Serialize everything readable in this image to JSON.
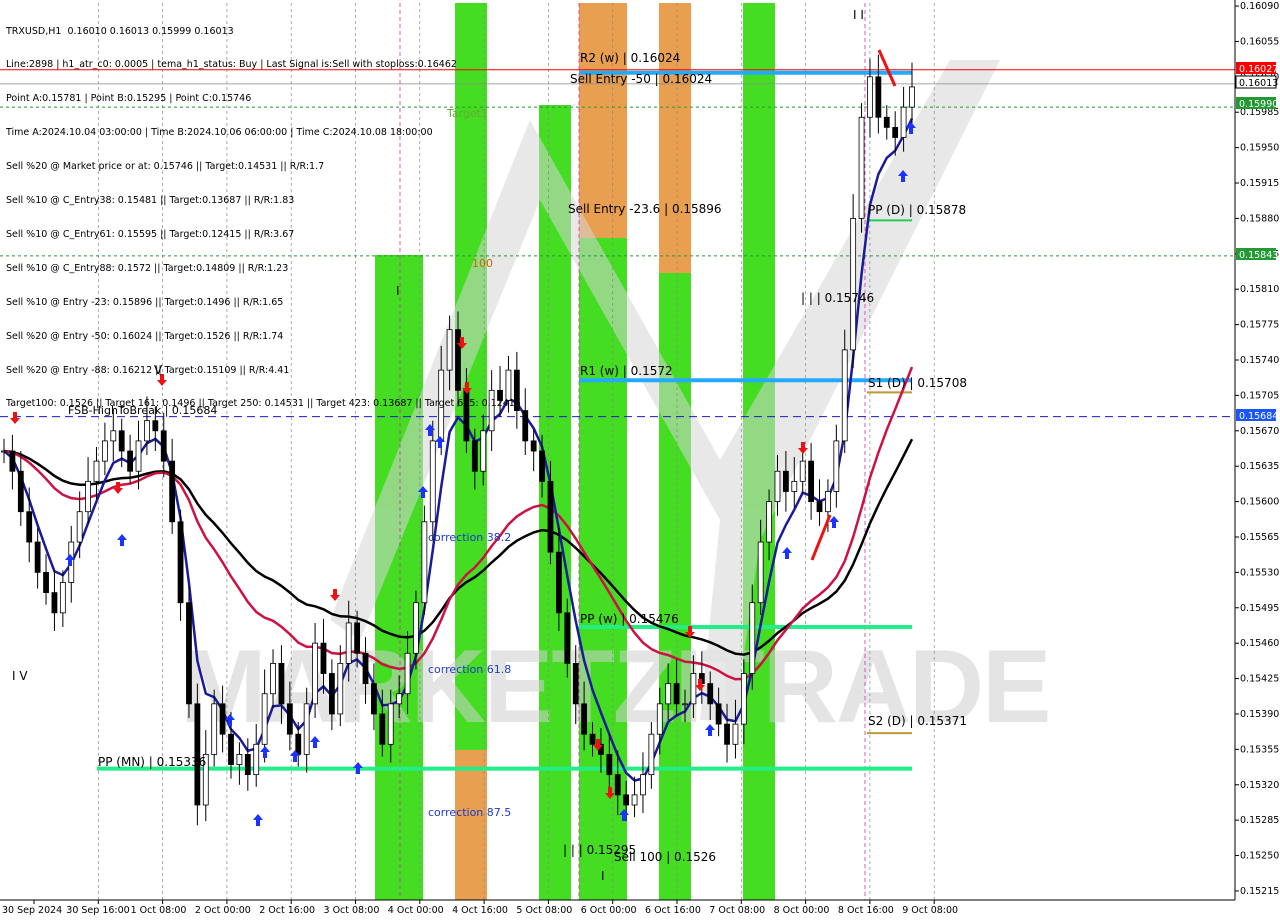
{
  "info": {
    "lines": [
      "TRXUSD,H1  0.16010 0.16013 0.15999 0.16013",
      "Line:2898 | h1_atr_c0: 0.0005 | tema_h1_status: Buy | Last Signal is:Sell with stoploss:0.16462",
      "Point A:0.15781 | Point B:0.15295 | Point C:0.15746",
      "Time A:2024.10.04 03:00:00 | Time B:2024.10.06 06:00:00 | Time C:2024.10.08 18:00:00",
      "Sell %20 @ Market price or at: 0.15746 || Target:0.14531 || R/R:1.7",
      "Sell %10 @ C_Entry38: 0.15481 || Target:0.13687 || R/R:1.83",
      "Sell %10 @ C_Entry61: 0.15595 || Target:0.12415 || R/R:3.67",
      "Sell %10 @ C_Entry88: 0.1572 || Target:0.14809 || R/R:1.23",
      "Sell %10 @ Entry -23: 0.15896 || Target:0.1496 || R/R:1.65",
      "Sell %20 @ Entry -50: 0.16024 || Target:0.1526 || R/R:1.74",
      "Sell %20 @ Entry -88: 0.16212 || Target:0.15109 || R/R:4.41",
      "Target100: 0.1526 || Target 161: 0.1496 || Target 250: 0.14531 || Target 423: 0.13687 || Target 685: 0.12415"
    ]
  },
  "colors": {
    "green": "#44dd22",
    "orange": "#e8a050",
    "blue_level": "#22aaff",
    "green_level": "#22ee88",
    "red_line": "#ff0000",
    "dark_blue": "#1a1a9a",
    "crimson": "#cc1144",
    "black": "#000000",
    "watermark": "#d8d8d8"
  },
  "price_tags": {
    "red": "0.16027",
    "black": "0.16013",
    "green1": "0.15990",
    "green2": "0.15843",
    "blue": "0.15684"
  },
  "levels": {
    "r2w": "R2 (w) | 0.16024",
    "sell_entry_50": "Sell Entry -50 | 0.16024",
    "target1": "Target1",
    "sell_entry_23": "Sell Entry -23.6 | 0.15896",
    "ppd": "PP (D) | 0.15878",
    "c_level": "| | | 0.15746",
    "r1w": "R1 (w) | 0.1572",
    "s1d": "S1 (D) | 0.15708",
    "fsb": "FSB-HighToBreak | 0.15684",
    "correction382": "correction 38.2",
    "ppw": "PP (w) | 0.15476",
    "correction618": "correction 61.8",
    "s2d": "S2 (D) | 0.15371",
    "ppmn": "PP (MN) | 0.15336",
    "correction875": "correction 87.5",
    "b_level": "| | | 0.15295",
    "sell100": "Sell 100 | 0.1526",
    "hundred": "100",
    "wave_v": "V",
    "wave_iv": "I V",
    "wave_top": "I  I",
    "wave_i": "I",
    "wave_b": "I"
  },
  "watermark": "MARKETZITRADE",
  "chart_data": {
    "type": "line",
    "symbol": "TRXUSD",
    "timeframe": "H1",
    "ylim": [
      0.1521,
      0.16093
    ],
    "y_ticks": [
      "0.16090",
      "0.16055",
      "0.16020",
      "0.15985",
      "0.15950",
      "0.15915",
      "0.15880",
      "0.15845",
      "0.15810",
      "0.15775",
      "0.15740",
      "0.15705",
      "0.15670",
      "0.15635",
      "0.15600",
      "0.15565",
      "0.15530",
      "0.15495",
      "0.15460",
      "0.15425",
      "0.15390",
      "0.15355",
      "0.15320",
      "0.15285",
      "0.15250",
      "0.15215"
    ],
    "x_ticks": [
      "30 Sep 2024",
      "30 Sep 16:00",
      "1 Oct 08:00",
      "2 Oct 00:00",
      "2 Oct 16:00",
      "3 Oct 08:00",
      "4 Oct 00:00",
      "4 Oct 16:00",
      "5 Oct 08:00",
      "6 Oct 00:00",
      "6 Oct 16:00",
      "7 Oct 08:00",
      "8 Oct 00:00",
      "8 Oct 16:00",
      "9 Oct 08:00"
    ],
    "horizontal_levels": [
      {
        "name": "R2 (w)",
        "value": 0.16024
      },
      {
        "name": "R1 (w)",
        "value": 0.1572
      },
      {
        "name": "PP (w)",
        "value": 0.15476
      },
      {
        "name": "PP (MN)",
        "value": 0.15336
      },
      {
        "name": "PP (D)",
        "value": 0.15878
      },
      {
        "name": "S1 (D)",
        "value": 0.15708
      },
      {
        "name": "S2 (D)",
        "value": 0.15371
      },
      {
        "name": "FSB-HighToBreak",
        "value": 0.15684
      }
    ],
    "close": [
      0.1565,
      0.1563,
      0.1559,
      0.1556,
      0.1553,
      0.1551,
      0.1549,
      0.1552,
      0.1556,
      0.1559,
      0.1562,
      0.1564,
      0.1566,
      0.1567,
      0.1565,
      0.1563,
      0.1566,
      0.1568,
      0.1567,
      0.1564,
      0.1558,
      0.155,
      0.154,
      0.153,
      0.1535,
      0.154,
      0.1537,
      0.1534,
      0.1535,
      0.1533,
      0.1536,
      0.1541,
      0.1544,
      0.154,
      0.1537,
      0.1535,
      0.154,
      0.1546,
      0.1543,
      0.1539,
      0.1544,
      0.1548,
      0.1545,
      0.1542,
      0.1539,
      0.1536,
      0.154,
      0.1541,
      0.1545,
      0.155,
      0.1558,
      0.1566,
      0.1573,
      0.1577,
      0.1571,
      0.1566,
      0.1563,
      0.1567,
      0.1571,
      0.157,
      0.1573,
      0.1569,
      0.1566,
      0.1565,
      0.1562,
      0.1555,
      0.1549,
      0.1544,
      0.154,
      0.1537,
      0.1536,
      0.1535,
      0.1533,
      0.1531,
      0.153,
      0.1531,
      0.1533,
      0.1537,
      0.154,
      0.1542,
      0.154,
      0.154,
      0.1543,
      0.1542,
      0.154,
      0.1538,
      0.1536,
      0.1538,
      0.1543,
      0.155,
      0.1556,
      0.156,
      0.1563,
      0.1561,
      0.1562,
      0.1564,
      0.156,
      0.1559,
      0.1561,
      0.1566,
      0.1575,
      0.1588,
      0.1598,
      0.1602,
      0.1598,
      0.1597,
      0.1596,
      0.1599,
      0.1601
    ]
  }
}
